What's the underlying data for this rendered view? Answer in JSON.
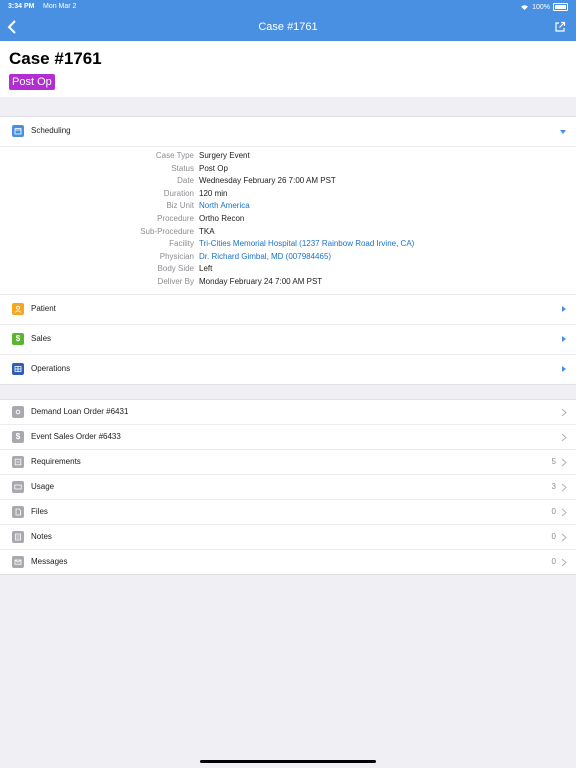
{
  "status_bar": {
    "time": "3:34 PM",
    "date": "Mon Mar 2",
    "battery": "100%"
  },
  "nav": {
    "title": "Case #1761"
  },
  "header": {
    "title": "Case #1761",
    "status": "Post Op",
    "status_color": "#b12fd0"
  },
  "sections": {
    "scheduling": {
      "label": "Scheduling"
    },
    "patient": {
      "label": "Patient"
    },
    "sales": {
      "label": "Sales"
    },
    "operations": {
      "label": "Operations"
    }
  },
  "details": [
    {
      "label": "Case Type",
      "value": "Surgery Event",
      "link": false
    },
    {
      "label": "Status",
      "value": "Post Op",
      "link": false
    },
    {
      "label": "Date",
      "value": "Wednesday February 26 7:00 AM PST",
      "link": false
    },
    {
      "label": "Duration",
      "value": "120 min",
      "link": false
    },
    {
      "label": "Biz Unit",
      "value": "North America",
      "link": true
    },
    {
      "label": "Procedure",
      "value": "Ortho Recon",
      "link": false
    },
    {
      "label": "Sub-Procedure",
      "value": "TKA",
      "link": false
    },
    {
      "label": "Facility",
      "value": "Tri-Cities Memorial Hospital (1237 Rainbow Road Irvine, CA)",
      "link": true
    },
    {
      "label": "Physician",
      "value": "Dr. Richard  Gimbal, MD (007984465)",
      "link": true
    },
    {
      "label": "Body Side",
      "value": "Left",
      "link": false
    },
    {
      "label": "Deliver By",
      "value": "Monday February 24 7:00 AM PST",
      "link": false
    }
  ],
  "related": [
    {
      "label": "Demand Loan Order #6431",
      "count": ""
    },
    {
      "label": "Event Sales Order #6433",
      "count": ""
    },
    {
      "label": "Requirements",
      "count": "5"
    },
    {
      "label": "Usage",
      "count": "3"
    },
    {
      "label": "Files",
      "count": "0"
    },
    {
      "label": "Notes",
      "count": "0"
    },
    {
      "label": "Messages",
      "count": "0"
    }
  ],
  "colors": {
    "accent": "#4a90e2",
    "link": "#1a73c9"
  }
}
